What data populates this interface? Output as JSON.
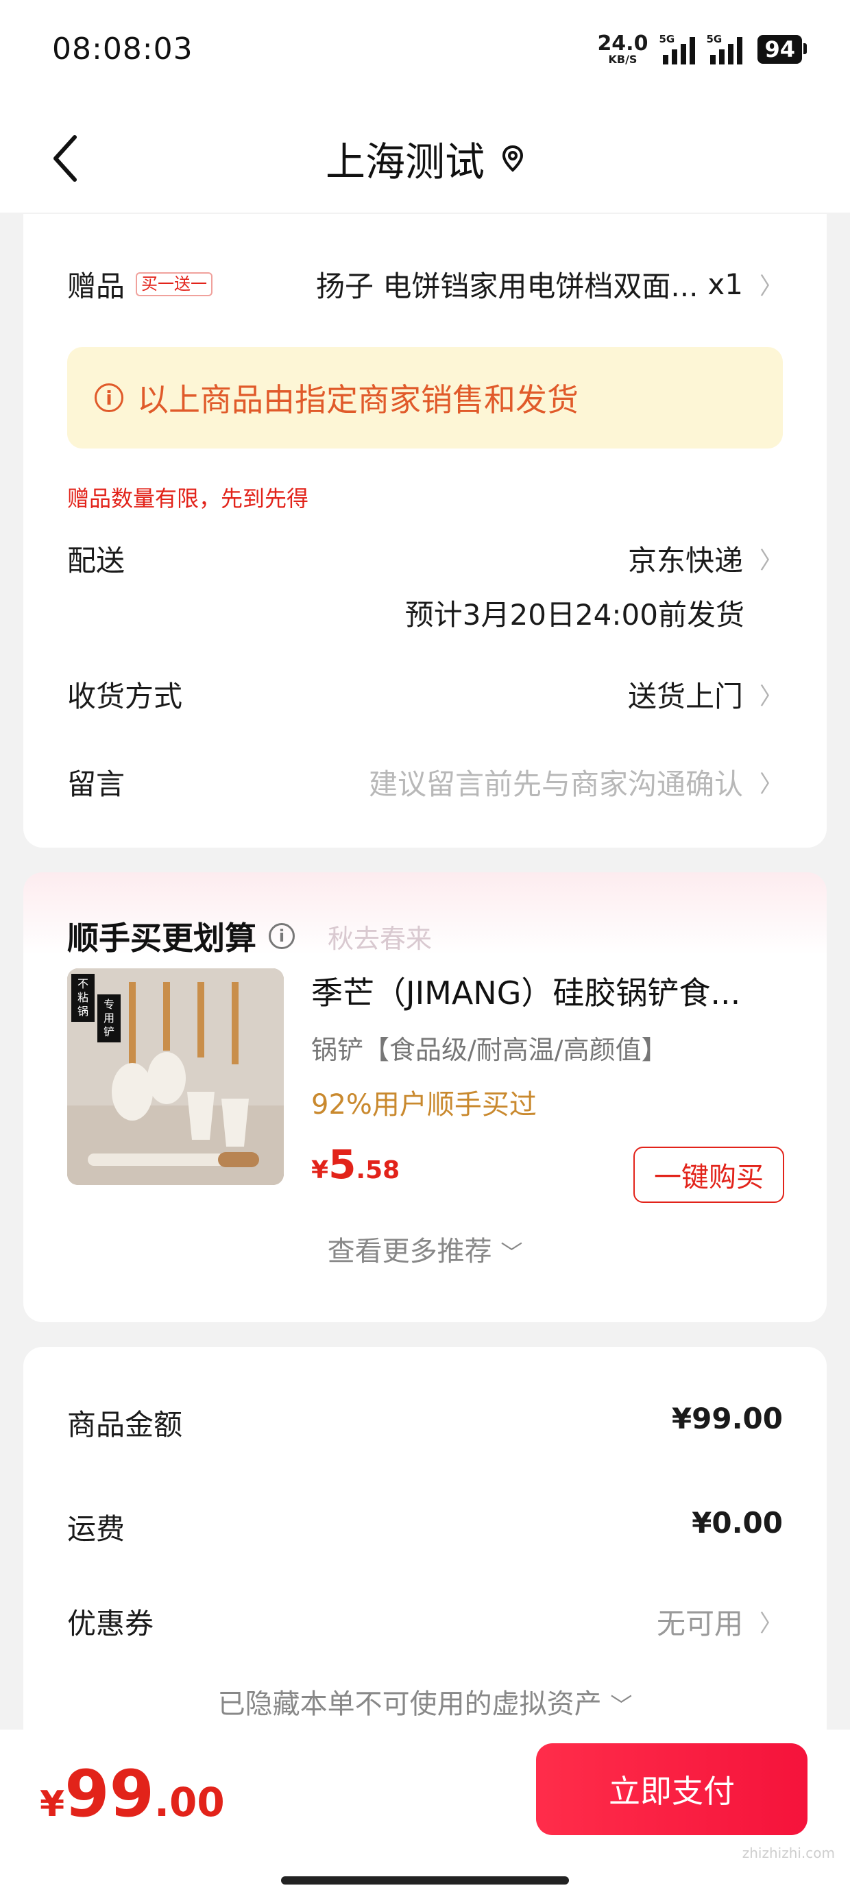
{
  "status_bar": {
    "time": "08:08:03",
    "net_speed": "24.0",
    "net_unit": "KB/S",
    "signal1_label": "5G",
    "signal2_label": "5G",
    "battery": "94"
  },
  "nav": {
    "title": "上海测试"
  },
  "order_card": {
    "gift_label": "赠品",
    "gift_tag": "买一送一",
    "gift_value": "扬子 电饼铛家用电饼档双面...",
    "gift_qty": "x1",
    "notice_text": "以上商品由指定商家销售和发货",
    "limit_text": "赠品数量有限，先到先得",
    "delivery_label": "配送",
    "delivery_value": "京东快递",
    "delivery_eta": "预计3月20日24:00前发货",
    "receive_label": "收货方式",
    "receive_value": "送货上门",
    "note_label": "留言",
    "note_placeholder": "建议留言前先与商家沟通确认"
  },
  "recommend": {
    "title": "顺手买更划算",
    "faded_text": "秋去春来",
    "product_title": "季芒（JIMANG）硅胶锅铲食...",
    "product_sub": "锅铲【食品级/耐高温/高颜值】",
    "product_rate": "92%用户顺手买过",
    "price_cur": "¥",
    "price_int": "5",
    "price_dec": ".58",
    "buy_label": "一键购买",
    "more_label": "查看更多推荐",
    "thumb_text_1": "不粘锅",
    "thumb_text_2": "专用铲"
  },
  "summary": {
    "goods_label": "商品金额",
    "goods_value": "¥99.00",
    "ship_label": "运费",
    "ship_value": "¥0.00",
    "coupon_label": "优惠券",
    "coupon_value": "无可用",
    "hidden_assets": "已隐藏本单不可使用的虚拟资产"
  },
  "bottom": {
    "total_cur": "¥",
    "total_int": "99",
    "total_dec": ".00",
    "pay_label": "立即支付"
  },
  "watermark": "zhizhizhi.com",
  "colors": {
    "accent_red": "#e2231a",
    "notice_bg": "#fdf6d6",
    "notice_text": "#e05a2a",
    "rate_gold": "#c9892e"
  }
}
